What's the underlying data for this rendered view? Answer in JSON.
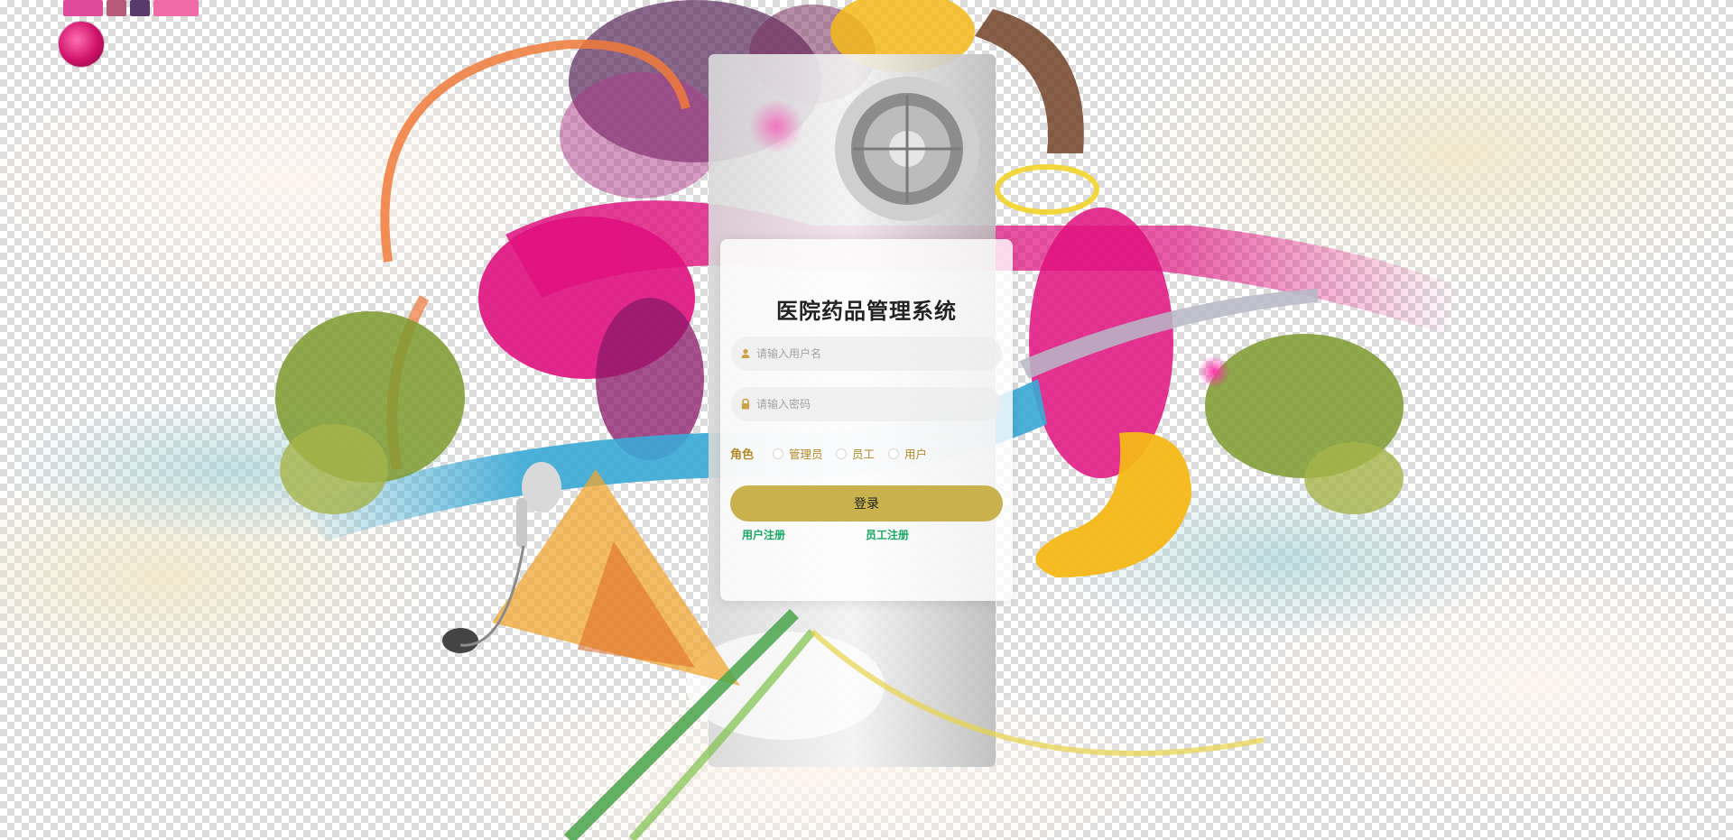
{
  "login": {
    "title": "医院药品管理系统",
    "username_placeholder": "请输入用户名",
    "password_placeholder": "请输入密码",
    "role_label": "角色",
    "roles": [
      "管理员",
      "员工",
      "用户"
    ],
    "submit_label": "登录",
    "register_user_label": "用户注册",
    "register_staff_label": "员工注册"
  },
  "icons": {
    "username": "user-icon",
    "password": "lock-icon"
  },
  "colors": {
    "button": "#c9b24e",
    "role_text": "#b08a25",
    "register_links": "#19a864",
    "magenta_accent": "#e0117f",
    "yellow_accent": "#f5b817"
  }
}
